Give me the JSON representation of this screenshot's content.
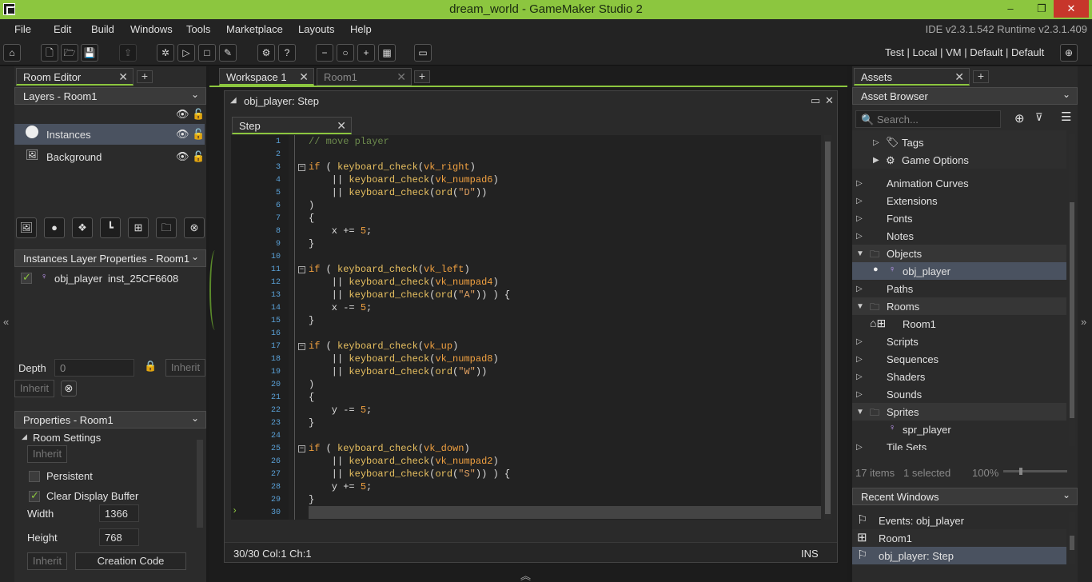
{
  "window": {
    "title": "dream_world - GameMaker Studio 2",
    "minimize": "–",
    "restore": "❐",
    "close": "✕"
  },
  "menu": [
    "File",
    "Edit",
    "Build",
    "Windows",
    "Tools",
    "Marketplace",
    "Layouts",
    "Help"
  ],
  "version": "IDE v2.3.1.542  Runtime v2.3.1.409",
  "targets": "Test  |  Local  |  VM  |  Default  |  Default",
  "left": {
    "tab": "Room Editor",
    "layers_dropdown": "Layers - Room1",
    "layers": [
      "Instances",
      "Background"
    ],
    "instances_dropdown": "Instances Layer Properties - Room1",
    "instance": {
      "object": "obj_player",
      "id": "inst_25CF6608"
    },
    "depth_label": "Depth",
    "depth_value": "0",
    "inherit": "Inherit",
    "properties_dropdown": "Properties - Room1",
    "room_settings": "Room Settings",
    "persistent": "Persistent",
    "clear_buffer": "Clear Display Buffer",
    "width_label": "Width",
    "width_value": "1366",
    "height_label": "Height",
    "height_value": "768",
    "creation_code": "Creation Code"
  },
  "workspace": {
    "tabs": [
      "Workspace 1",
      "Room1"
    ],
    "window_title": "obj_player: Step",
    "event_tab": "Step",
    "status": "30/30 Col:1 Ch:1",
    "mode": "INS"
  },
  "code_lines": [
    "// move player",
    "",
    "if ( keyboard_check(vk_right)",
    "    || keyboard_check(vk_numpad6)",
    "    || keyboard_check(ord(\"D\"))",
    ")",
    "{",
    "    x += 5;",
    "}",
    "",
    "if ( keyboard_check(vk_left)",
    "    || keyboard_check(vk_numpad4)",
    "    || keyboard_check(ord(\"A\")) ) {",
    "    x -= 5;",
    "}",
    "",
    "if ( keyboard_check(vk_up)",
    "    || keyboard_check(vk_numpad8)",
    "    || keyboard_check(ord(\"W\"))",
    ")",
    "{",
    "    y -= 5;",
    "}",
    "",
    "if ( keyboard_check(vk_down)",
    "    || keyboard_check(vk_numpad2)",
    "    || keyboard_check(ord(\"S\")) ) {",
    "    y += 5;",
    "}",
    ""
  ],
  "assets": {
    "tab": "Assets",
    "browser_dropdown": "Asset Browser",
    "search_placeholder": "Search...",
    "top_items": [
      "Tags",
      "Game Options"
    ],
    "groups": [
      "Animation Curves",
      "Extensions",
      "Fonts",
      "Notes",
      "Objects",
      "obj_player",
      "Paths",
      "Rooms",
      "Room1",
      "Scripts",
      "Sequences",
      "Shaders",
      "Sounds",
      "Sprites",
      "spr_player",
      "Tile Sets"
    ],
    "count": "17 items",
    "selected": "1 selected",
    "zoom": "100%"
  },
  "recent": {
    "dropdown": "Recent Windows",
    "items": [
      "Events: obj_player",
      "Room1",
      "obj_player: Step"
    ]
  },
  "colors": {
    "accent": "#8cc63f",
    "close": "#c7362b",
    "selected_row": "#4a5260"
  }
}
